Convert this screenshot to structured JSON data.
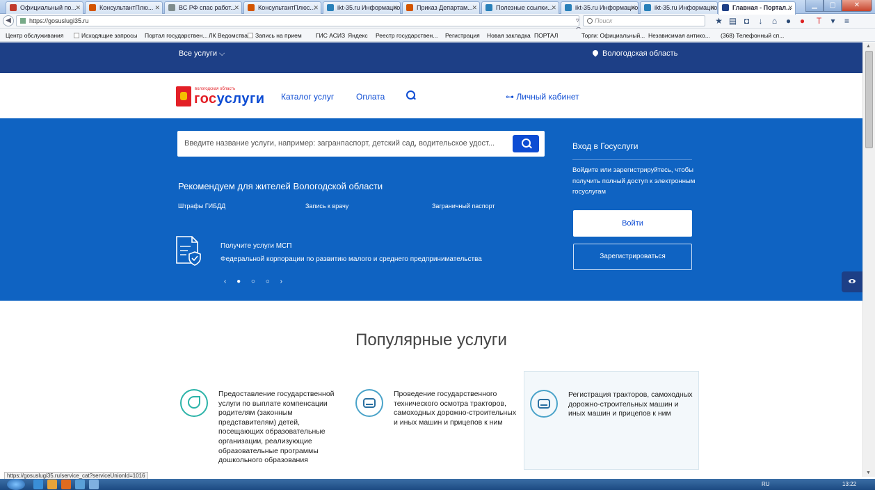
{
  "browser": {
    "tabs": [
      {
        "label": "Официальный по...",
        "color": "#c0392b"
      },
      {
        "label": "КонсультантПлю...",
        "color": "#d35400"
      },
      {
        "label": "ВС РФ спас работ...",
        "color": "#7f8c8d"
      },
      {
        "label": "КонсультантПлюс...",
        "color": "#d35400"
      },
      {
        "label": "ikt-35.ru Информацио...",
        "color": "#2980b9"
      },
      {
        "label": "Приказ Департам...",
        "color": "#d35400"
      },
      {
        "label": "Полезные ссылки...",
        "color": "#2980b9"
      },
      {
        "label": "ikt-35.ru Информацио...",
        "color": "#2980b9"
      },
      {
        "label": "ikt-35.ru Информацио...",
        "color": "#2980b9"
      },
      {
        "label": "Главная - Портал...",
        "color": "#1d3f86",
        "active": true
      }
    ],
    "url": "https://gosuslugi35.ru",
    "search_placeholder": "Поиск",
    "bookmarks": [
      "Центр обслуживания",
      "Исходящие запросы",
      "Портал государствен...",
      "ЛК Ведомства",
      "Запись на прием",
      "ГИС АСИЗ",
      "Яндекс",
      "Реестр государствен...",
      "Регистрация",
      "Новая закладка",
      "ПОРТАЛ",
      "Торги: Официальный...",
      "Независимая антико...",
      "(368) Телефонный сп..."
    ],
    "status_url": "https://gosuslugi35.ru/service_cat?serviceUnionId=1016"
  },
  "topbar": {
    "all_services": "Все услуги ⌵",
    "region": "Вологодская область"
  },
  "header": {
    "logo_small": "вологодская область",
    "logo_gos": "гос",
    "logo_uslugi": "услуги",
    "catalog": "Каталог услуг",
    "payment": "Оплата",
    "cabinet": "⊶ Личный кабинет"
  },
  "hero": {
    "search_placeholder": "Введите название услуги, например: загранпаспорт, детский сад, водительское удост...",
    "recommend_title": "Рекомендуем для жителей Вологодской области",
    "recommended": [
      "Штрафы ГИБДД",
      "Запись к врачу",
      "Заграничный паспорт"
    ],
    "promo_title": "Получите услуги МСП",
    "promo_subtitle": "Федеральной корпорации по развитию малого и среднего предпринимательства",
    "carousel": "‹ ● ○ ○ ›",
    "login_title": "Вход в Госуслуги",
    "login_text": "Войдите или зарегистрируйтесь, чтобы получить полный доступ к электронным госуслугам",
    "login_button": "Войти",
    "register_button": "Зарегистрироваться"
  },
  "popular": {
    "title": "Популярные услуги",
    "cards": [
      {
        "text": "Предоставление государственной услуги по выплате компенсации родителям (законным представителям) детей, посещающих образовательные организации, реализующие образовательные программы дошкольного образования",
        "icon": "pram-icon"
      },
      {
        "text": "Проведение государственного технического осмотра тракторов, самоходных дорожно-строительных и иных машин и прицепов к ним",
        "icon": "car-icon"
      },
      {
        "text": "Регистрация тракторов, самоходных дорожно-строительных машин и иных машин и прицепов к ним",
        "icon": "car-icon"
      }
    ]
  },
  "taskbar": {
    "tray": "RU",
    "clock": "13:22"
  },
  "colors": {
    "brand_blue": "#0f63c2",
    "dark_blue": "#1d3f86",
    "link_blue": "#0d4cd3",
    "logo_red": "#e31f26"
  }
}
